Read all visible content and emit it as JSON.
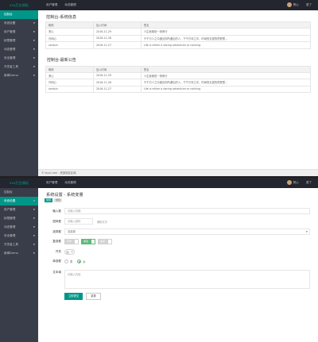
{
  "app": {
    "logo": "xxx后台模板",
    "top_nav": [
      "用户管理",
      "动态管理"
    ],
    "user_name": "贤心",
    "logout_label": "退了"
  },
  "sidebar": {
    "items": [
      {
        "label": "控制台",
        "expandable": false
      },
      {
        "label": "系统设置",
        "expandable": true
      },
      {
        "label": "用户管理",
        "expandable": true
      },
      {
        "label": "权限管理",
        "expandable": true
      },
      {
        "label": "动态管理",
        "expandable": true
      },
      {
        "label": "安全管理",
        "expandable": true
      },
      {
        "label": "开发者工具",
        "expandable": true
      },
      {
        "label": "新闻Demo",
        "expandable": true
      }
    ],
    "shot1_active": 0,
    "shot2_active": 1
  },
  "dashboard": {
    "section1_title": "控制台-系统信息",
    "section2_title": "控制台-最新公告",
    "table_headers": [
      "昵称",
      "加入时间",
      "签名"
    ],
    "rows": [
      [
        "贤心",
        "2016-11-29",
        "人生就像是一场修行"
      ],
      [
        "许闲心",
        "2016-11-28",
        "于干万人之中遇见你所遇见的人，于千万年之中，时间的无涯的荒野里…"
      ],
      [
        "sentsin",
        "2016-11-27",
        "Life is either a daring adventure or nothing."
      ]
    ],
    "footer": "© layui.com - 底部固定区域"
  },
  "settings_form": {
    "title": "系统设置 - 系统变量",
    "crumbs": [
      "常用",
      "规划"
    ],
    "input_label": "输入框",
    "input_placeholder": "请输入标题",
    "password_label": "密码框",
    "password_placeholder": "请输入密码",
    "password_hint": "辅助文字",
    "select_label": "选择框",
    "select_value": "请选择",
    "checkbox_label": "复选框",
    "checkboxes": [
      {
        "label": "写作",
        "checked": false
      },
      {
        "label": "阅读",
        "checked": true
      },
      {
        "label": "发呆",
        "checked": false
      }
    ],
    "switch_label": "开关",
    "switch_text": "关",
    "radio_label": "单选框",
    "radios": [
      {
        "label": "男",
        "checked": false
      },
      {
        "label": "女",
        "checked": true
      }
    ],
    "textarea_label": "文本域",
    "textarea_placeholder": "请输入内容",
    "submit_label": "立即提交",
    "reset_label": "重置"
  },
  "colors": {
    "accent": "#009688",
    "sidebar_bg": "#393d49",
    "topbar_bg": "#23262e",
    "checked_green": "#5fb878"
  }
}
